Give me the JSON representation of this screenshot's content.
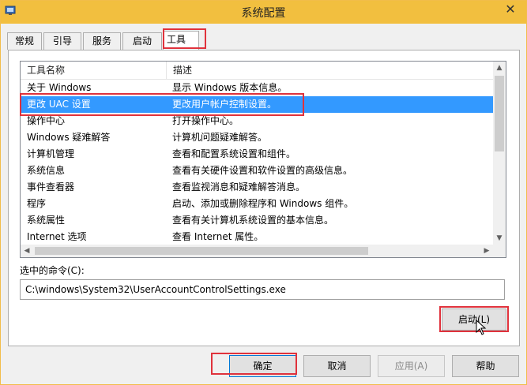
{
  "window": {
    "title": "系统配置",
    "close_glyph": "✕"
  },
  "tabs": [
    {
      "label": "常规",
      "active": false
    },
    {
      "label": "引导",
      "active": false
    },
    {
      "label": "服务",
      "active": false
    },
    {
      "label": "启动",
      "active": false
    },
    {
      "label": "工具",
      "active": true
    }
  ],
  "list": {
    "columns": [
      "工具名称",
      "描述"
    ],
    "rows": [
      {
        "name": "关于 Windows",
        "desc": "显示 Windows 版本信息。",
        "selected": false
      },
      {
        "name": "更改 UAC 设置",
        "desc": "更改用户帐户控制设置。",
        "selected": true
      },
      {
        "name": "操作中心",
        "desc": "打开操作中心。",
        "selected": false
      },
      {
        "name": "Windows 疑难解答",
        "desc": "计算机问题疑难解答。",
        "selected": false
      },
      {
        "name": "计算机管理",
        "desc": "查看和配置系统设置和组件。",
        "selected": false
      },
      {
        "name": "系统信息",
        "desc": "查看有关硬件设置和软件设置的高级信息。",
        "selected": false
      },
      {
        "name": "事件查看器",
        "desc": "查看监视消息和疑难解答消息。",
        "selected": false
      },
      {
        "name": "程序",
        "desc": "启动、添加或删除程序和 Windows 组件。",
        "selected": false
      },
      {
        "name": "系统属性",
        "desc": "查看有关计算机系统设置的基本信息。",
        "selected": false
      },
      {
        "name": "Internet 选项",
        "desc": "查看 Internet 属性。",
        "selected": false
      }
    ]
  },
  "command": {
    "label": "选中的命令(C):",
    "value": "C:\\windows\\System32\\UserAccountControlSettings.exe"
  },
  "buttons": {
    "launch": "启动(L)",
    "ok": "确定",
    "cancel": "取消",
    "apply": "应用(A)",
    "help": "帮助"
  },
  "icons": {
    "app": "msconfig-icon",
    "close": "close-icon",
    "scroll_up": "▲",
    "scroll_down": "▼",
    "scroll_left": "◀",
    "scroll_right": "▶"
  },
  "colors": {
    "titlebar": "#f2bf3f",
    "selection": "#3399ff",
    "highlight": "#e0323c"
  }
}
